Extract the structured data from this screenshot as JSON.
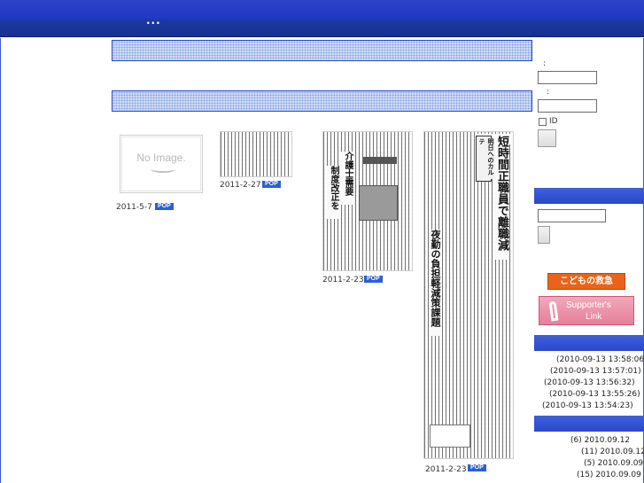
{
  "header": {
    "title": "..."
  },
  "sections": {
    "bar1_label": "",
    "bar2_label": ""
  },
  "clippings": [
    {
      "date": "2011-5-7",
      "badge": "POP",
      "no_image_text": "No Image."
    },
    {
      "date": "2011-2-27",
      "badge": "POP"
    },
    {
      "date": "2011-2-23",
      "badge": "POP",
      "headline_a": "介護士需要",
      "headline_b": "制度改正を"
    },
    {
      "date": "2011-2-23",
      "badge": "POP",
      "headline_a": "短時間正職員で離職減",
      "headline_b": "夜勤の負担軽減策課題",
      "column": "明日へのカルテ"
    }
  ],
  "login": {
    "label1": ":",
    "label2": ":",
    "remember_label": "ID"
  },
  "banners": {
    "kodomo": "こどもの救急",
    "supporters_line1": "Supporter's",
    "supporters_line2": "Link"
  },
  "recent_entries": [
    "(2010-09-13 13:58:06)",
    "(2010-09-13 13:57:01)",
    "(2010-09-13 13:56:32)",
    "(2010-09-13 13:55:26)",
    "(2010-09-13 13:54:23)"
  ],
  "archive": [
    "(6) 2010.09.12",
    "(11) 2010.09.12",
    "(5) 2010.09.09",
    "(15) 2010.09.09"
  ],
  "colors": {
    "header": "#1f37c2",
    "accent": "#2a48c8",
    "pop_badge": "#2a5fd6"
  }
}
